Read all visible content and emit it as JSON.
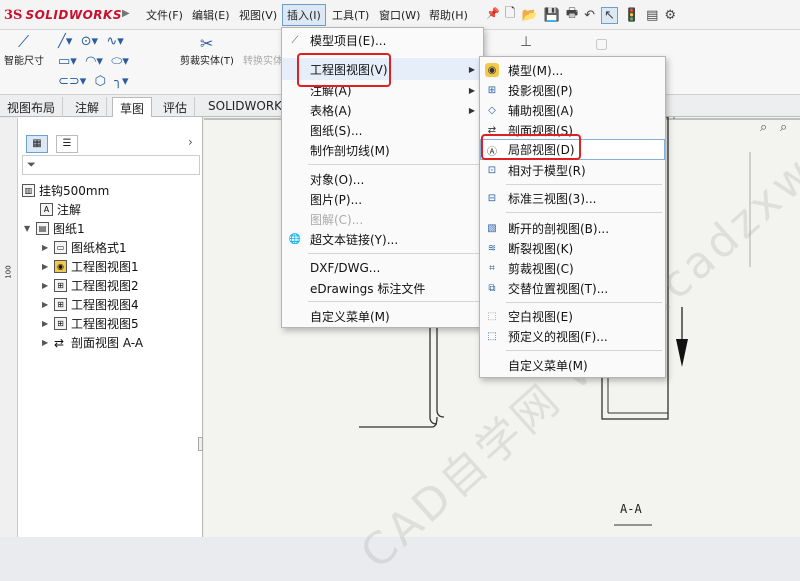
{
  "app": {
    "logo_ds": "3S",
    "logo_text": "SOLIDWORKS"
  },
  "menubar": [
    "文件(F)",
    "编辑(E)",
    "视图(V)",
    "插入(I)",
    "工具(T)",
    "窗口(W)",
    "帮助(H)"
  ],
  "toolbar": {
    "smart_dim": "智能尺寸",
    "trim": "剪裁实体(T)",
    "convert": "转换实体"
  },
  "tabs": [
    "视图布局",
    "注解",
    "草图",
    "评估",
    "SOLIDWORKS"
  ],
  "tree": {
    "root": "挂钩500mm",
    "annotation": "注解",
    "sheet": "图纸1",
    "children": [
      "图纸格式1",
      "工程图视图1",
      "工程图视图2",
      "工程图视图4",
      "工程图视图5",
      "剖面视图 A-A"
    ]
  },
  "insert_menu": [
    "模型项目(E)...",
    "工程图视图(V)",
    "注解(A)",
    "表格(A)",
    "图纸(S)...",
    "制作剖切线(M)",
    "对象(O)...",
    "图片(P)...",
    "图解(C)...",
    "超文本链接(Y)...",
    "DXF/DWG...",
    "eDrawings 标注文件",
    "自定义菜单(M)"
  ],
  "views_menu": [
    "模型(M)...",
    "投影视图(P)",
    "辅助视图(A)",
    "剖面视图(S)",
    "局部视图(D)",
    "相对于模型(R)",
    "标准三视图(3)...",
    "断开的剖视图(B)...",
    "断裂视图(K)",
    "剪裁视图(C)",
    "交替位置视图(T)...",
    "空白视图(E)",
    "预定义的视图(F)...",
    "自定义菜单(M)"
  ],
  "canvas": {
    "section_label": "A-A",
    "ruler_mark": "100"
  },
  "watermark": "CAD自学网 www.cadzxw.com",
  "colors": {
    "highlight_box": "#e02020",
    "accent": "#2a5d9f"
  }
}
